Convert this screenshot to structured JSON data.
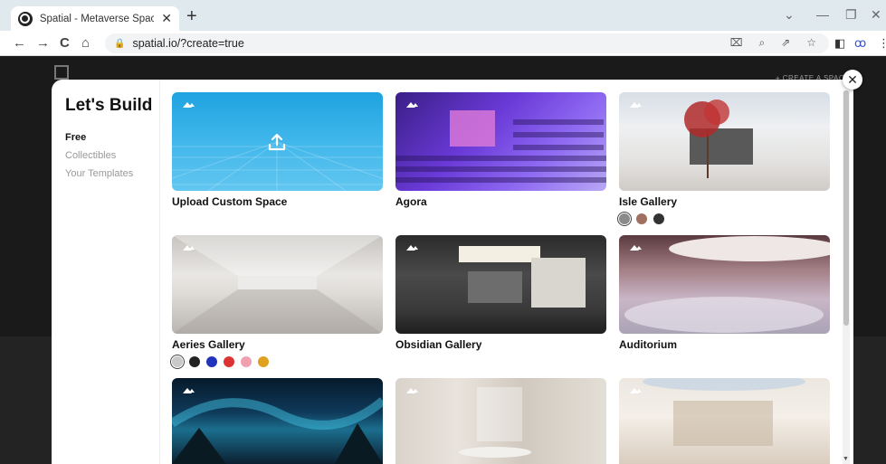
{
  "browser": {
    "tab_title": "Spatial - Metaverse Spaces That I",
    "tab_close": "✕",
    "new_tab": "+",
    "url": "spatial.io/?create=true",
    "nav": {
      "back": "←",
      "forward": "→",
      "reload": "C",
      "home": "⌂"
    }
  },
  "background": {
    "create_label": "+ CREATE A SPACE"
  },
  "modal": {
    "close": "✕",
    "sidebar": {
      "title": "Let's Build",
      "items": [
        {
          "label": "Free",
          "active": true
        },
        {
          "label": "Collectibles",
          "active": false
        },
        {
          "label": "Your Templates",
          "active": false
        }
      ]
    },
    "cards": [
      {
        "label": "Upload Custom Space",
        "icon": "upload-icon",
        "swatches": []
      },
      {
        "label": "Agora",
        "swatches": []
      },
      {
        "label": "Isle Gallery",
        "swatches": [
          "#8a8a8a",
          "#a07060",
          "#333333"
        ]
      },
      {
        "label": "Aeries Gallery",
        "swatches": [
          "#c8c8c8",
          "#222222",
          "#2233bb",
          "#dd3333",
          "#f0a0b0",
          "#e0a020"
        ]
      },
      {
        "label": "Obsidian Gallery",
        "swatches": []
      },
      {
        "label": "Auditorium",
        "swatches": []
      },
      {
        "label": "",
        "swatches": []
      },
      {
        "label": "",
        "swatches": []
      },
      {
        "label": "",
        "swatches": []
      }
    ]
  },
  "colors": {
    "accent": "#29a9e5",
    "tabbar": "#dfe9ee"
  }
}
